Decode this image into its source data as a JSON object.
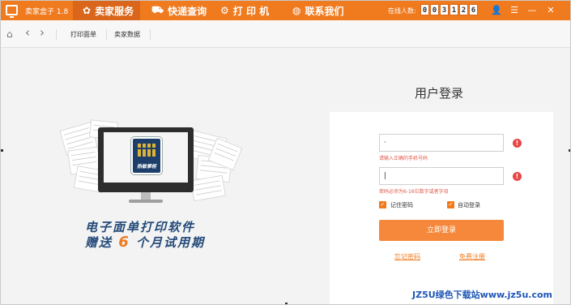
{
  "app": {
    "title": "卖家盒子 1.8"
  },
  "nav": [
    {
      "label": "卖家服务",
      "icon": "bag-icon",
      "glyph": "✿"
    },
    {
      "label": "快递查询",
      "icon": "truck-icon",
      "glyph": "⛟"
    },
    {
      "label": "打 印 机",
      "icon": "gear-icon",
      "glyph": "⚙"
    },
    {
      "label": "联系我们",
      "icon": "globe-icon",
      "glyph": "◍"
    }
  ],
  "online": {
    "label": "在线人数:",
    "digits": [
      "0",
      "0",
      "3",
      "1",
      "2",
      "6"
    ]
  },
  "window_controls": {
    "user": "👤",
    "menu": "☰",
    "minimize": "—",
    "close": "✕"
  },
  "toolbar": {
    "home": "⌂",
    "back": "‹",
    "forward": "›",
    "tabs": [
      "打印面单",
      "卖家数据"
    ]
  },
  "promo": {
    "line1": "电子面单打印软件",
    "line2_pre": "赠送 ",
    "line2_num": "6",
    "line2_post": " 个月试用期",
    "logo_text": "热敏掌柜"
  },
  "login": {
    "title": "用户登录",
    "phone_value": "·",
    "phone_hint": "请输入正确的手机号码",
    "password_value": "|",
    "password_hint": "密码必须为6-16位数字或者字母",
    "remember_label": "记住密码",
    "auto_login_label": "自动登录",
    "submit": "立即登录",
    "forgot": "忘记密码",
    "register": "免费注册",
    "error_mark": "!"
  },
  "watermark": "JZ5U绿色下载站www.jz5u.com",
  "colors": {
    "accent": "#f07a1e",
    "brand_blue": "#244a79",
    "error": "#e84545"
  }
}
